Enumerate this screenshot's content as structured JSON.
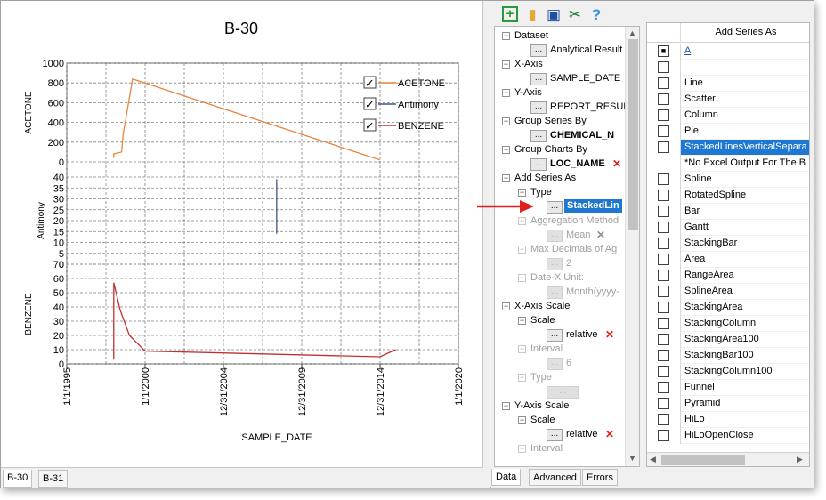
{
  "chart": {
    "title": "B-30",
    "xlabel": "SAMPLE_DATE",
    "x_ticks": [
      "1/1/1995",
      "1/1/2000",
      "12/31/2004",
      "12/31/2009",
      "12/31/2014",
      "1/1/2020"
    ],
    "panels": [
      {
        "ylabel": "ACETONE",
        "ticks": [
          "1000",
          "800",
          "600",
          "400",
          "200",
          "0"
        ]
      },
      {
        "ylabel": "Antimony",
        "ticks": [
          "40",
          "35",
          "30",
          "25",
          "20",
          "15",
          "10",
          "5",
          "0"
        ]
      },
      {
        "ylabel": "BENZENE",
        "ticks": [
          "70",
          "60",
          "50",
          "40",
          "30",
          "20",
          "10",
          "0"
        ]
      }
    ],
    "legend": [
      {
        "label": "ACETONE",
        "color": "#e8843c",
        "checked": true
      },
      {
        "label": "Antimony",
        "color": "#405880",
        "checked": true
      },
      {
        "label": "BENZENE",
        "color": "#c03030",
        "checked": true
      }
    ]
  },
  "chart_data": {
    "type": "line",
    "title": "B-30",
    "xlabel": "SAMPLE_DATE",
    "xlim": [
      "1/1/1995",
      "1/1/2020"
    ],
    "series": [
      {
        "name": "ACETONE",
        "ylim": [
          0,
          1000
        ],
        "points": [
          [
            "1/1/1998",
            40
          ],
          [
            "1/1/1998",
            80
          ],
          [
            "1/1/1998.5",
            100
          ],
          [
            "7/1/1998",
            280
          ],
          [
            "3/1/1999",
            840
          ],
          [
            "12/31/2014",
            20
          ]
        ]
      },
      {
        "name": "Antimony",
        "ylim": [
          0,
          40
        ],
        "points": [
          [
            "6/1/2008",
            14
          ],
          [
            "6/1/2008",
            39
          ]
        ]
      },
      {
        "name": "BENZENE",
        "ylim": [
          0,
          70
        ],
        "points": [
          [
            "1/1/1998",
            3
          ],
          [
            "1/1/1998",
            57
          ],
          [
            "6/1/1998",
            38
          ],
          [
            "1/1/1999",
            20
          ],
          [
            "1/1/2000",
            9
          ],
          [
            "12/31/2014",
            5
          ],
          [
            "1/1/2016",
            10
          ]
        ]
      }
    ]
  },
  "chart_tabs": [
    "B-30",
    "B-31"
  ],
  "toolbar": {
    "icons": [
      "add-chart-icon",
      "open-folder-icon",
      "save-icon",
      "scissors-icon",
      "help-icon"
    ]
  },
  "tree": {
    "dataset": {
      "label": "Dataset",
      "value": "Analytical Result"
    },
    "xaxis": {
      "label": "X-Axis",
      "value": "SAMPLE_DATE"
    },
    "yaxis": {
      "label": "Y-Axis",
      "value": "REPORT_RESUL"
    },
    "group_series": {
      "label": "Group Series By",
      "value": "CHEMICAL_N"
    },
    "group_charts": {
      "label": "Group Charts By",
      "value": "LOC_NAME"
    },
    "add_series": {
      "label": "Add Series As"
    },
    "type": {
      "label": "Type",
      "value": "StackedLin"
    },
    "aggregation": {
      "label": "Aggregation Method",
      "value": "Mean"
    },
    "max_decimals": {
      "label": "Max Decimals of Ag",
      "value": "2"
    },
    "date_x": {
      "label": "Date-X Unit:",
      "value": "Month(yyyy-"
    },
    "xscale": {
      "label": "X-Axis Scale"
    },
    "xscale_scale": {
      "label": "Scale",
      "value": "relative"
    },
    "xscale_interval": {
      "label": "Interval",
      "value": "6"
    },
    "xscale_type": {
      "label": "Type"
    },
    "yscale": {
      "label": "Y-Axis Scale"
    },
    "yscale_scale": {
      "label": "Scale",
      "value": "relative"
    },
    "yscale_interval": {
      "label": "Interval"
    },
    "ellipsis": "..."
  },
  "grid": {
    "header": "Add Series As",
    "header_letter": "A",
    "items": [
      {
        "label": "",
        "checked": false
      },
      {
        "label": "Line",
        "checked": false
      },
      {
        "label": "Scatter",
        "checked": false
      },
      {
        "label": "Column",
        "checked": false
      },
      {
        "label": "Pie",
        "checked": false
      },
      {
        "label": "StackedLinesVerticalSepara",
        "checked": true,
        "selected": true
      },
      {
        "label": "*No Excel Output For The B",
        "checked": false,
        "nocheck": true
      },
      {
        "label": "Spline",
        "checked": false
      },
      {
        "label": "RotatedSpline",
        "checked": false
      },
      {
        "label": "Bar",
        "checked": false
      },
      {
        "label": "Gantt",
        "checked": false
      },
      {
        "label": "StackingBar",
        "checked": false
      },
      {
        "label": "Area",
        "checked": false
      },
      {
        "label": "RangeArea",
        "checked": false
      },
      {
        "label": "SplineArea",
        "checked": false
      },
      {
        "label": "StackingArea",
        "checked": false
      },
      {
        "label": "StackingColumn",
        "checked": false
      },
      {
        "label": "StackingArea100",
        "checked": false
      },
      {
        "label": "StackingBar100",
        "checked": false
      },
      {
        "label": "StackingColumn100",
        "checked": false
      },
      {
        "label": "Funnel",
        "checked": false
      },
      {
        "label": "Pyramid",
        "checked": false
      },
      {
        "label": "HiLo",
        "checked": false
      },
      {
        "label": "HiLoOpenClose",
        "checked": false
      }
    ]
  },
  "right_tabs": [
    "Data",
    "Advanced",
    "Errors"
  ],
  "colors": {
    "accent": "#1e78d2",
    "arrow": "#e02020"
  }
}
